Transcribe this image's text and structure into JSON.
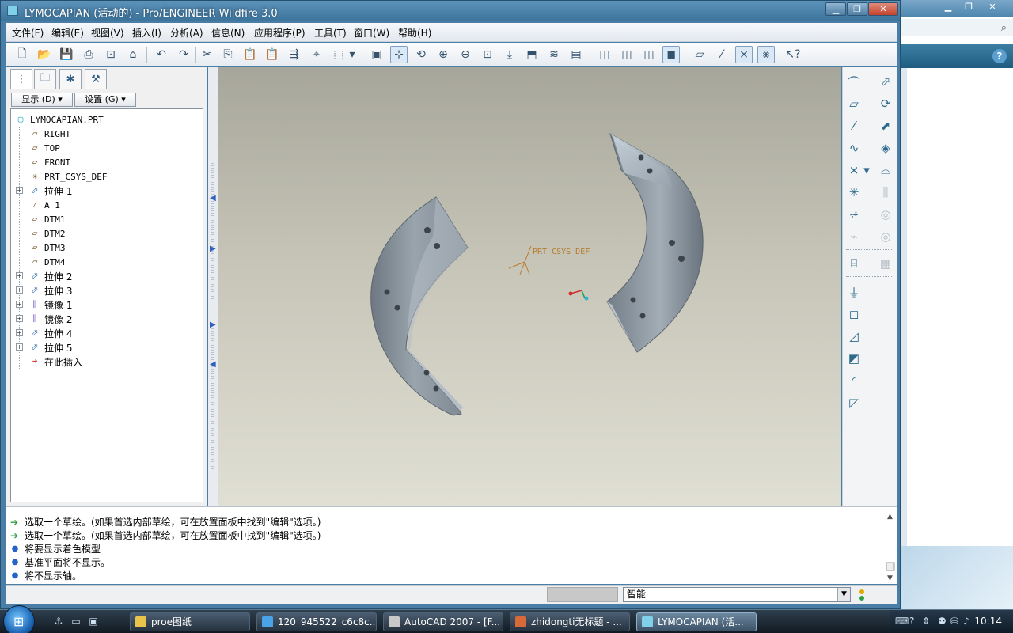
{
  "window": {
    "title": "LYMOCAPIAN (活动的) - Pro/ENGINEER Wildfire 3.0"
  },
  "menu": [
    "文件(F)",
    "编辑(E)",
    "视图(V)",
    "插入(I)",
    "分析(A)",
    "信息(N)",
    "应用程序(P)",
    "工具(T)",
    "窗口(W)",
    "帮助(H)"
  ],
  "toolbar": {
    "icons": [
      "new-icon",
      "open-icon",
      "save-icon",
      "print-icon",
      "print-preview-icon",
      "send-icon",
      "undo-icon",
      "redo-icon",
      "cut-icon",
      "copy-icon",
      "paste-icon",
      "paste-special-icon",
      "regenerate-icon",
      "find-icon",
      "select-box-icon",
      "select-dropdown-icon",
      "repaint-icon",
      "spin-center-icon",
      "orient-icon",
      "zoom-in-icon",
      "zoom-out-icon",
      "refit-icon",
      "reorient-icon",
      "saved-views-icon",
      "layers-icon",
      "view-manager-icon",
      "wireframe-icon",
      "hidden-line-icon",
      "no-hidden-icon",
      "shading-icon",
      "datum-planes-icon",
      "datum-axes-icon",
      "datum-points-icon",
      "csys-icon",
      "context-help-icon"
    ]
  },
  "navigator": {
    "display_button": "显示 (D)",
    "settings_button": "设置 (G)",
    "tree": [
      {
        "label": "LYMOCAPIAN.PRT",
        "icon": "part-icon",
        "indent": 0,
        "expand": false
      },
      {
        "label": "RIGHT",
        "icon": "datum-plane-icon",
        "indent": 1,
        "expand": false
      },
      {
        "label": "TOP",
        "icon": "datum-plane-icon",
        "indent": 1,
        "expand": false
      },
      {
        "label": "FRONT",
        "icon": "datum-plane-icon",
        "indent": 1,
        "expand": false
      },
      {
        "label": "PRT_CSYS_DEF",
        "icon": "csys-icon",
        "indent": 1,
        "expand": false
      },
      {
        "label": "拉伸 1",
        "icon": "extrude-icon",
        "indent": 1,
        "expand": true
      },
      {
        "label": "A_1",
        "icon": "axis-icon",
        "indent": 1,
        "expand": false
      },
      {
        "label": "DTM1",
        "icon": "datum-plane-icon",
        "indent": 1,
        "expand": false
      },
      {
        "label": "DTM2",
        "icon": "datum-plane-icon",
        "indent": 1,
        "expand": false
      },
      {
        "label": "DTM3",
        "icon": "datum-plane-icon",
        "indent": 1,
        "expand": false
      },
      {
        "label": "DTM4",
        "icon": "datum-plane-icon",
        "indent": 1,
        "expand": false
      },
      {
        "label": "拉伸 2",
        "icon": "extrude-icon",
        "indent": 1,
        "expand": true
      },
      {
        "label": "拉伸 3",
        "icon": "extrude-icon",
        "indent": 1,
        "expand": true
      },
      {
        "label": "镜像 1",
        "icon": "mirror-icon",
        "indent": 1,
        "expand": true
      },
      {
        "label": "镜像 2",
        "icon": "mirror-icon",
        "indent": 1,
        "expand": true
      },
      {
        "label": "拉伸 4",
        "icon": "extrude-icon",
        "indent": 1,
        "expand": true
      },
      {
        "label": "拉伸 5",
        "icon": "extrude-icon",
        "indent": 1,
        "expand": true
      },
      {
        "label": "在此插入",
        "icon": "insert-here-icon",
        "indent": 1,
        "expand": false
      }
    ]
  },
  "graphics": {
    "csys_label": "PRT_CSYS_DEF"
  },
  "messages": [
    {
      "type": "prompt",
      "text": "选取一个草绘。(如果首选内部草绘，可在放置面板中找到\"编辑\"选项。)"
    },
    {
      "type": "prompt",
      "text": "选取一个草绘。(如果首选内部草绘，可在放置面板中找到\"编辑\"选项。)"
    },
    {
      "type": "info",
      "text": "将要显示着色模型"
    },
    {
      "type": "info",
      "text": "基准平面将不显示。"
    },
    {
      "type": "info",
      "text": "将不显示轴。"
    }
  ],
  "status": {
    "filter": "智能"
  },
  "taskbar": {
    "tasks": [
      {
        "label": "proe图纸",
        "active": false
      },
      {
        "label": "120_945522_c6c8c...",
        "active": false
      },
      {
        "label": "AutoCAD 2007 - [F...",
        "active": false
      },
      {
        "label": "zhidongti无标题 - ...",
        "active": false
      },
      {
        "label": "LYMOCAPIAN (活...",
        "active": true
      }
    ],
    "clock": "10:14"
  },
  "colors": {
    "accent": "#3c739b",
    "model_gray": "#8a949d",
    "csys_orange": "#b87a2a"
  }
}
